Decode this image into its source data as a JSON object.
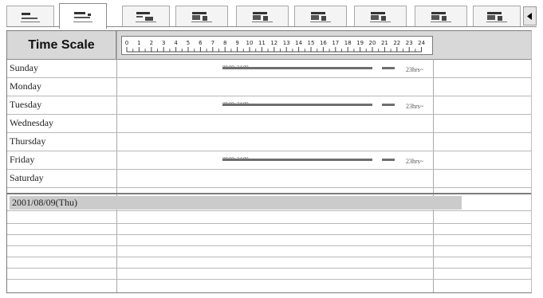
{
  "tabs": [
    {
      "icon": "gantt-view-icon",
      "active": false
    },
    {
      "icon": "gantt-view-icon",
      "active": true
    },
    {
      "icon": "gantt-view-icon",
      "active": false
    },
    {
      "icon": "gantt-view-icon",
      "active": false
    },
    {
      "icon": "gantt-view-icon",
      "active": false
    },
    {
      "icon": "gantt-view-icon",
      "active": false
    },
    {
      "icon": "gantt-view-icon",
      "active": false
    },
    {
      "icon": "gantt-view-icon",
      "active": false
    },
    {
      "icon": "gantt-view-icon",
      "active": false
    }
  ],
  "scroll_arrow_icon": "left-arrow-icon",
  "header": {
    "title": "Time Scale"
  },
  "ruler": {
    "hours": [
      "0",
      "1",
      "2",
      "3",
      "4",
      "5",
      "6",
      "7",
      "8",
      "9",
      "10",
      "11",
      "12",
      "13",
      "14",
      "15",
      "16",
      "17",
      "18",
      "19",
      "20",
      "21",
      "22",
      "23",
      "24"
    ]
  },
  "days": [
    {
      "name": "Sunday",
      "has_bar": true,
      "bar_label": "08:00~24:00",
      "end_label": "23hrs~"
    },
    {
      "name": "Monday",
      "has_bar": false
    },
    {
      "name": "Tuesday",
      "has_bar": true,
      "bar_label": "08:00~24:00",
      "end_label": "23hrs~"
    },
    {
      "name": "Wednesday",
      "has_bar": false
    },
    {
      "name": "Thursday",
      "has_bar": false
    },
    {
      "name": "Friday",
      "has_bar": true,
      "bar_label": "08:00~24:00",
      "end_label": "23hrs~"
    },
    {
      "name": "Saturday",
      "has_bar": false
    }
  ],
  "selected_entry": "2001/08/09(Thu)",
  "colors": {
    "header": "#d8d8d8",
    "bar": "#6e6e6e",
    "selection": "#cbcbcb"
  }
}
